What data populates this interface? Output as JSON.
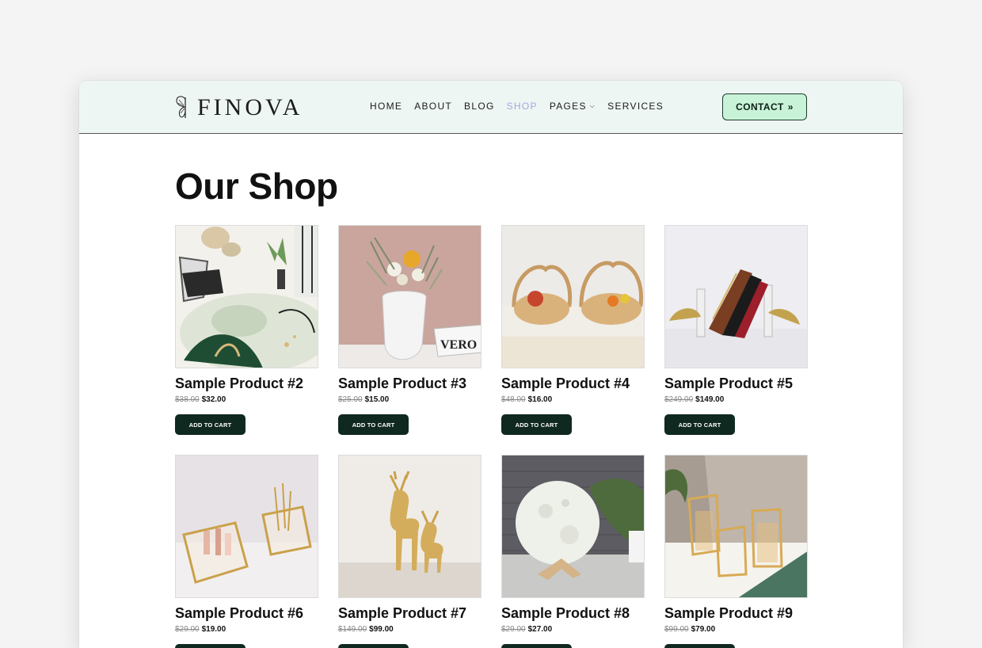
{
  "brand": {
    "logo_text": "FINOVA"
  },
  "nav": {
    "items": [
      "HOME",
      "ABOUT",
      "BLOG",
      "SHOP",
      "PAGES",
      "SERVICES"
    ],
    "active": "SHOP",
    "accent": "#a8a4e0"
  },
  "contact": {
    "label": "CONTACT",
    "icon": "double-chevron-right-icon"
  },
  "page": {
    "title": "Our Shop"
  },
  "cart_label": "ADD TO CART",
  "products": [
    {
      "name": "Sample Product #2",
      "old_price": "$38.00",
      "price": "$32.00"
    },
    {
      "name": "Sample Product #3",
      "old_price": "$25.00",
      "price": "$15.00"
    },
    {
      "name": "Sample Product #4",
      "old_price": "$48.00",
      "price": "$16.00"
    },
    {
      "name": "Sample Product #5",
      "old_price": "$249.00",
      "price": "$149.00"
    },
    {
      "name": "Sample Product #6",
      "old_price": "$29.00",
      "price": "$19.00"
    },
    {
      "name": "Sample Product #7",
      "old_price": "$149.00",
      "price": "$99.00"
    },
    {
      "name": "Sample Product #8",
      "old_price": "$29.00",
      "price": "$27.00"
    },
    {
      "name": "Sample Product #9",
      "old_price": "$99.00",
      "price": "$79.00"
    }
  ],
  "colors": {
    "header_bg": "#eef6f3",
    "contact_bg": "#c8f3d9",
    "button_dark": "#102920"
  }
}
